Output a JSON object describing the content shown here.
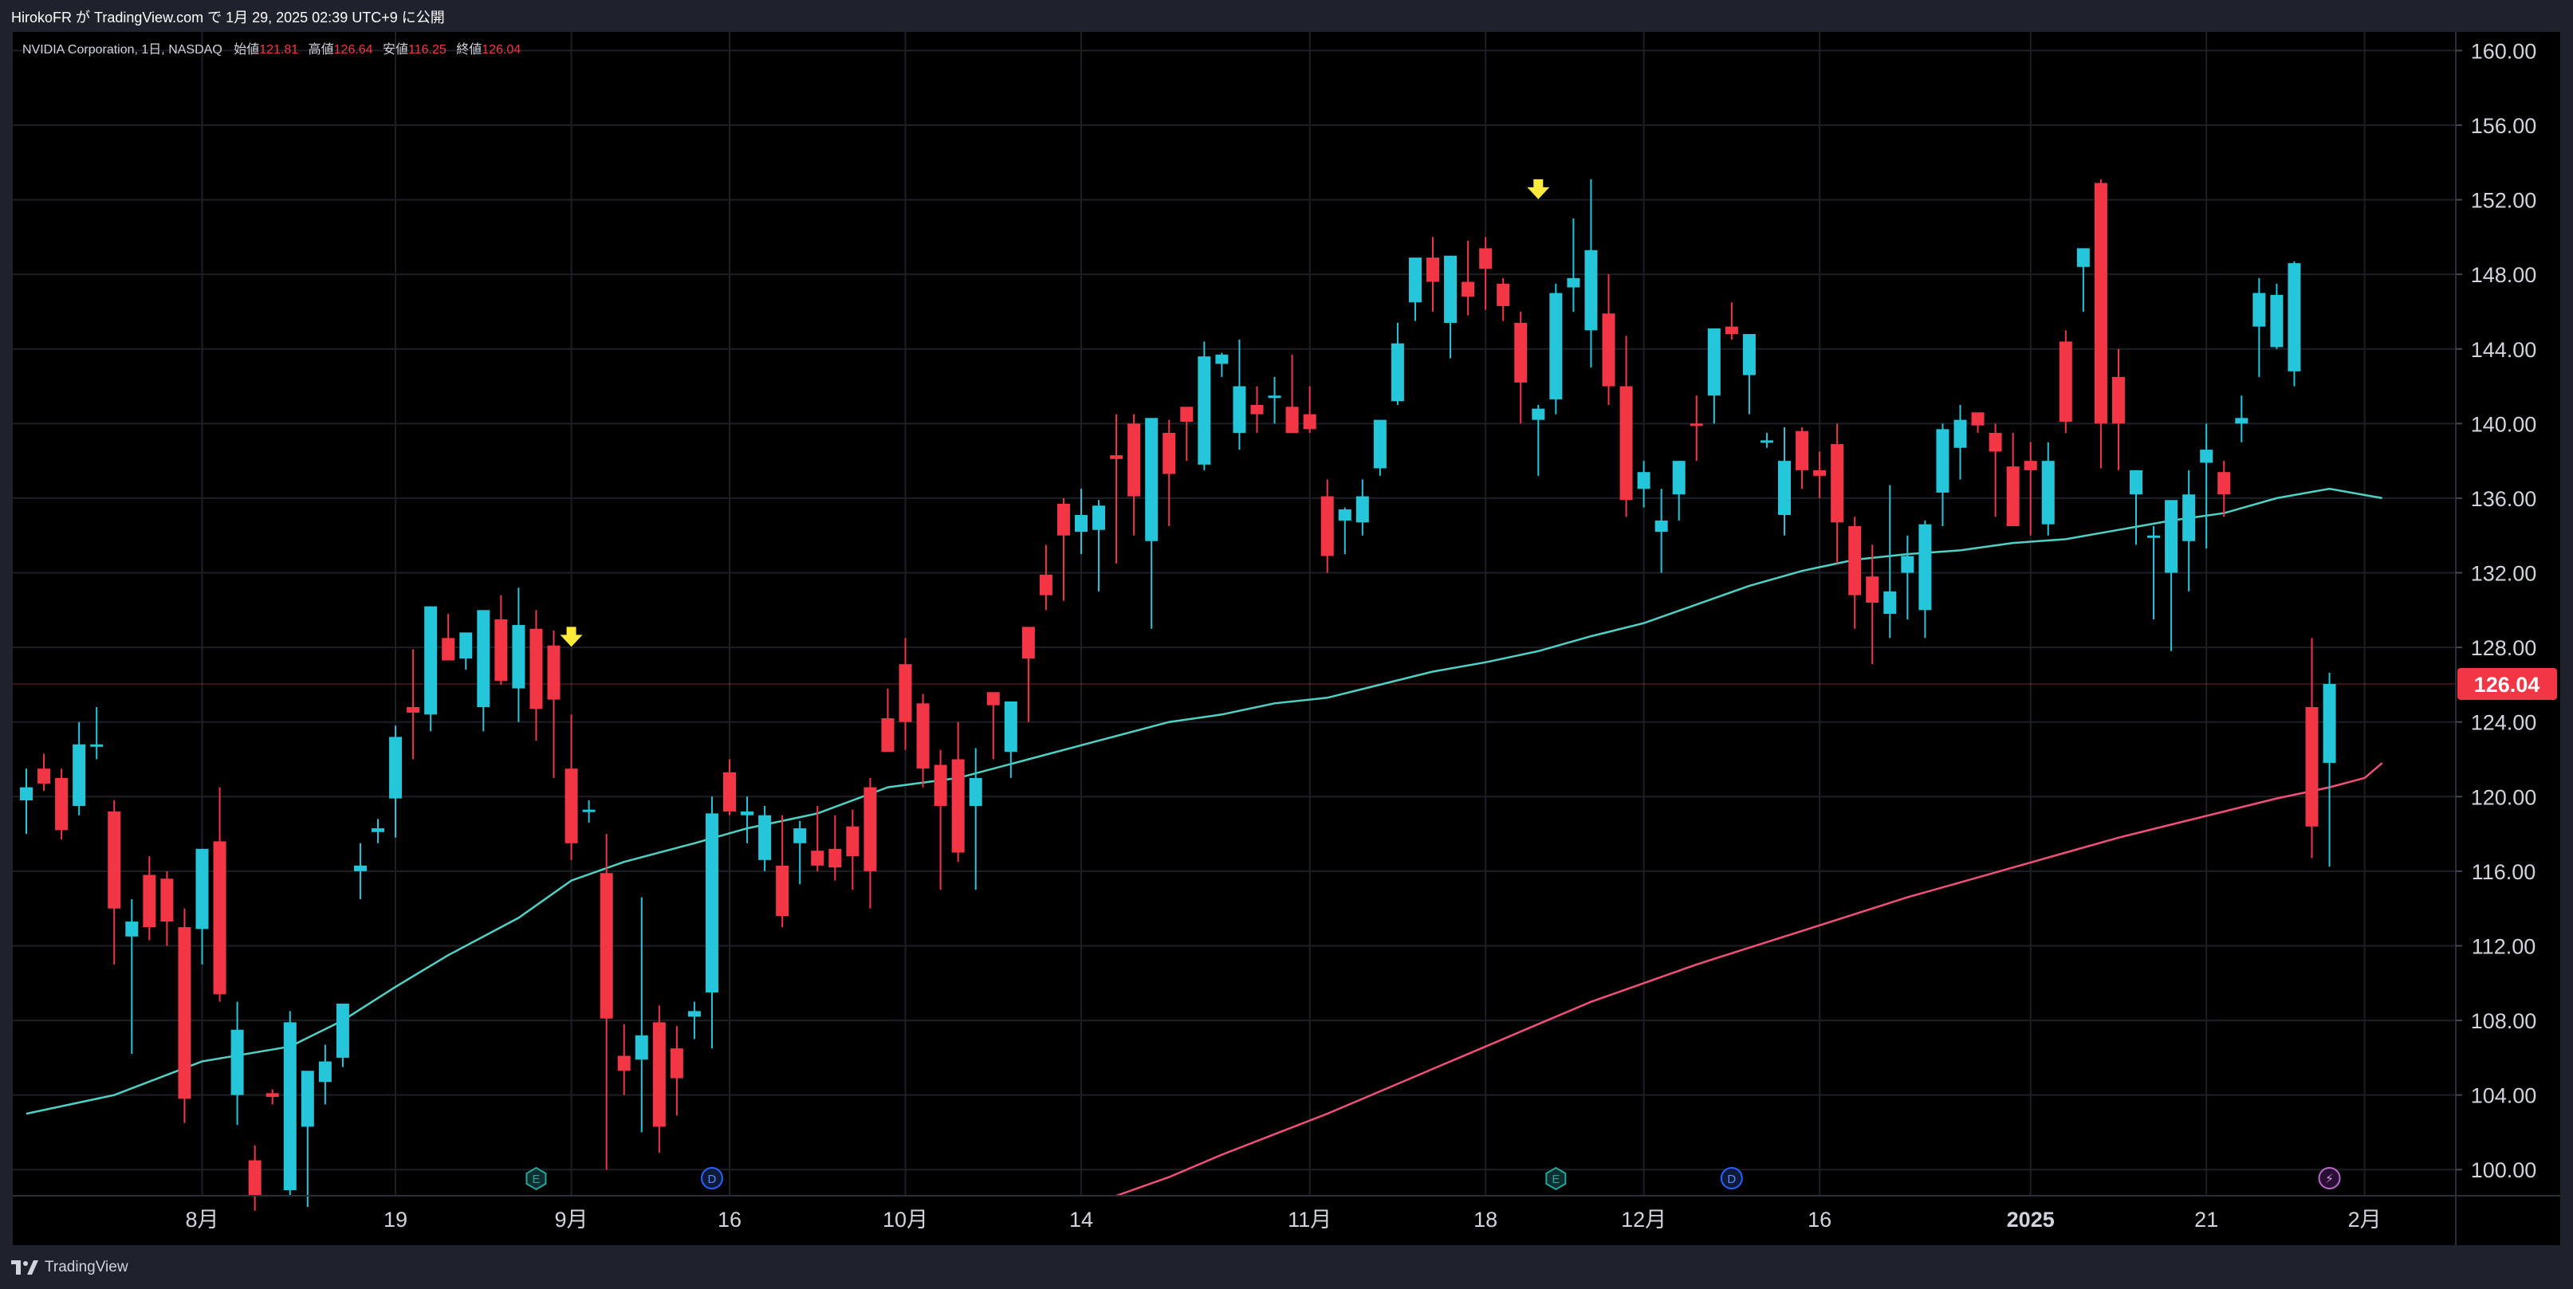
{
  "publish_line": "HirokoFR が TradingView.com で 1月 29, 2025 02:39 UTC+9 に公開",
  "brand": "TradingView",
  "colors": {
    "bull": "#26c6da",
    "bear": "#f23645",
    "ma_short": "#4fd1c5",
    "ma_long": "#f0507a",
    "marker": "#ffeb3b",
    "grid": "#1c1f26",
    "axis_text": "#d1d4dc",
    "last_price_line": "#f23645"
  },
  "legend": {
    "symbol": "NVIDIA Corporation, 1日, NASDAQ",
    "open_label": "始値",
    "open": "121.81",
    "high_label": "高値",
    "high": "126.64",
    "low_label": "安値",
    "low": "116.25",
    "close_label": "終値",
    "close": "126.04"
  },
  "chart_data": {
    "type": "candlestick",
    "symbol": "NVIDIA Corporation",
    "interval": "1日",
    "exchange": "NASDAQ",
    "y_ticks": [
      "160.00",
      "156.00",
      "152.00",
      "148.00",
      "144.00",
      "140.00",
      "136.00",
      "132.00",
      "128.00",
      "124.00",
      "120.00",
      "116.00",
      "112.00",
      "108.00",
      "104.00",
      "100.00"
    ],
    "ylim": [
      98.6,
      161.0
    ],
    "x_ticks": [
      {
        "label": "8月",
        "index": 10
      },
      {
        "label": "19",
        "index": 21
      },
      {
        "label": "9月",
        "index": 31
      },
      {
        "label": "16",
        "index": 40
      },
      {
        "label": "10月",
        "index": 50
      },
      {
        "label": "14",
        "index": 60
      },
      {
        "label": "11月",
        "index": 73
      },
      {
        "label": "18",
        "index": 83
      },
      {
        "label": "12月",
        "index": 92
      },
      {
        "label": "16",
        "index": 102
      },
      {
        "label": "2025",
        "index": 114,
        "bold": true
      },
      {
        "label": "21",
        "index": 124
      },
      {
        "label": "2月",
        "index": 133
      }
    ],
    "last_price": 126.04,
    "candles": [
      [
        119.8,
        121.5,
        118.0,
        120.5
      ],
      [
        121.5,
        122.3,
        120.3,
        120.7
      ],
      [
        121.0,
        121.5,
        117.7,
        118.2
      ],
      [
        119.5,
        124.0,
        119.0,
        122.8
      ],
      [
        122.7,
        124.8,
        122.0,
        122.8
      ],
      [
        119.2,
        119.8,
        111.0,
        114.0
      ],
      [
        112.5,
        114.5,
        106.2,
        113.3
      ],
      [
        115.8,
        116.8,
        112.3,
        113.0
      ],
      [
        115.6,
        116.0,
        112.0,
        113.3
      ],
      [
        113.0,
        114.0,
        102.5,
        103.8
      ],
      [
        112.9,
        116.8,
        111.0,
        117.2
      ],
      [
        117.6,
        120.5,
        109.0,
        109.4
      ],
      [
        104.0,
        109.0,
        102.4,
        107.5
      ],
      [
        100.5,
        101.3,
        97.8,
        98.6
      ],
      [
        104.1,
        104.3,
        103.5,
        103.9
      ],
      [
        98.9,
        108.5,
        98.6,
        107.9
      ],
      [
        102.3,
        105.1,
        98.0,
        105.3
      ],
      [
        104.7,
        106.7,
        103.5,
        105.8
      ],
      [
        106.0,
        108.0,
        105.5,
        108.9
      ],
      [
        116.0,
        117.5,
        114.5,
        116.3
      ],
      [
        118.1,
        118.8,
        117.5,
        118.3
      ],
      [
        119.9,
        123.8,
        117.8,
        123.2
      ],
      [
        124.8,
        127.9,
        122.0,
        124.5
      ],
      [
        124.4,
        130.2,
        123.5,
        130.2
      ],
      [
        128.5,
        129.8,
        127.8,
        127.3
      ],
      [
        127.4,
        128.8,
        126.8,
        128.8
      ],
      [
        124.8,
        130.0,
        123.5,
        130.0
      ],
      [
        129.5,
        130.8,
        126.0,
        126.2
      ],
      [
        125.8,
        131.2,
        124.0,
        129.2
      ],
      [
        129.0,
        130.0,
        123.0,
        124.7
      ],
      [
        128.1,
        128.9,
        121.0,
        125.2
      ],
      [
        121.5,
        124.4,
        116.6,
        117.5
      ],
      [
        119.3,
        119.8,
        118.6,
        119.3
      ],
      [
        115.9,
        118.0,
        100.0,
        108.1
      ],
      [
        106.1,
        107.8,
        104.0,
        105.3
      ],
      [
        105.9,
        114.6,
        102.0,
        107.2
      ],
      [
        107.9,
        108.8,
        100.9,
        102.3
      ],
      [
        106.5,
        107.7,
        102.9,
        104.9
      ],
      [
        108.2,
        109.0,
        107.0,
        108.5
      ],
      [
        109.5,
        120.0,
        106.5,
        119.1
      ],
      [
        121.3,
        122.0,
        119.0,
        119.2
      ],
      [
        119.0,
        120.0,
        117.5,
        119.2
      ],
      [
        116.6,
        119.5,
        116.0,
        119.0
      ],
      [
        116.3,
        119.0,
        113.0,
        113.6
      ],
      [
        117.5,
        118.7,
        115.3,
        118.3
      ],
      [
        117.1,
        119.5,
        116.0,
        116.3
      ],
      [
        117.2,
        119.0,
        115.5,
        116.2
      ],
      [
        118.4,
        119.3,
        115.0,
        116.8
      ],
      [
        120.5,
        121.0,
        114.0,
        116.0
      ],
      [
        124.2,
        125.8,
        123.5,
        122.4
      ],
      [
        127.1,
        128.5,
        122.5,
        124.0
      ],
      [
        125.0,
        125.5,
        120.5,
        121.5
      ],
      [
        121.7,
        122.5,
        115.0,
        119.5
      ],
      [
        122.0,
        124.0,
        116.5,
        117.0
      ],
      [
        119.5,
        122.6,
        115.0,
        121.0
      ],
      [
        125.6,
        125.5,
        122.0,
        124.9
      ],
      [
        122.4,
        124.9,
        121.0,
        125.1
      ],
      [
        129.1,
        129.0,
        124.0,
        127.4
      ],
      [
        131.9,
        133.5,
        130.0,
        130.8
      ],
      [
        135.7,
        136.0,
        130.5,
        134.0
      ],
      [
        134.2,
        136.5,
        133.0,
        135.1
      ],
      [
        134.3,
        135.9,
        131.0,
        135.6
      ],
      [
        138.3,
        140.5,
        132.5,
        138.1
      ],
      [
        140.0,
        140.5,
        134.0,
        136.1
      ],
      [
        133.7,
        139.5,
        129.0,
        140.3
      ],
      [
        139.5,
        140.2,
        134.5,
        137.3
      ],
      [
        140.9,
        140.5,
        138.0,
        140.1
      ],
      [
        137.8,
        144.4,
        137.5,
        143.6
      ],
      [
        143.2,
        143.8,
        142.5,
        143.7
      ],
      [
        139.5,
        144.5,
        138.6,
        142.0
      ],
      [
        141.0,
        142.0,
        139.5,
        140.5
      ],
      [
        141.4,
        142.5,
        140.0,
        141.5
      ],
      [
        140.9,
        143.7,
        139.5,
        139.5
      ],
      [
        140.5,
        142.0,
        139.5,
        139.7
      ],
      [
        136.1,
        137.0,
        132.0,
        132.9
      ],
      [
        134.8,
        135.5,
        133.0,
        135.4
      ],
      [
        134.7,
        137.0,
        134.0,
        136.1
      ],
      [
        137.6,
        139.7,
        137.2,
        140.2
      ],
      [
        141.2,
        145.4,
        141.0,
        144.3
      ],
      [
        146.5,
        147.5,
        145.5,
        148.9
      ],
      [
        148.9,
        150.0,
        146.0,
        147.6
      ],
      [
        145.4,
        149.0,
        143.5,
        149.0
      ],
      [
        147.6,
        149.8,
        145.8,
        146.8
      ],
      [
        149.4,
        150.0,
        146.1,
        148.3
      ],
      [
        147.5,
        147.8,
        145.5,
        146.3
      ],
      [
        145.4,
        146.0,
        140.0,
        142.2
      ],
      [
        140.2,
        141.0,
        137.2,
        140.8
      ],
      [
        141.3,
        147.5,
        140.5,
        147.0
      ],
      [
        147.3,
        151.0,
        146.0,
        147.8
      ],
      [
        145.0,
        153.1,
        143.0,
        149.3
      ],
      [
        145.9,
        148.0,
        141.0,
        142.0
      ],
      [
        142.0,
        144.7,
        135.0,
        135.9
      ],
      [
        136.5,
        138.0,
        135.5,
        137.4
      ],
      [
        134.2,
        136.5,
        132.0,
        134.8
      ],
      [
        136.2,
        138.0,
        134.8,
        138.0
      ],
      [
        140.0,
        141.5,
        138.0,
        139.9
      ],
      [
        141.5,
        145.0,
        140.0,
        145.1
      ],
      [
        145.2,
        146.5,
        144.5,
        144.8
      ],
      [
        142.6,
        144.5,
        140.5,
        144.8
      ],
      [
        139.0,
        139.5,
        138.7,
        139.1
      ],
      [
        135.1,
        139.8,
        134.0,
        138.0
      ],
      [
        139.6,
        139.8,
        136.5,
        137.5
      ],
      [
        137.5,
        138.5,
        136.0,
        137.2
      ],
      [
        138.9,
        140.0,
        132.5,
        134.7
      ],
      [
        134.5,
        135.0,
        129.0,
        130.8
      ],
      [
        131.8,
        133.5,
        127.1,
        130.4
      ],
      [
        129.8,
        136.7,
        128.5,
        131.0
      ],
      [
        132.0,
        134.0,
        129.5,
        132.9
      ],
      [
        130.0,
        134.8,
        128.5,
        134.6
      ],
      [
        136.3,
        140.0,
        134.5,
        139.7
      ],
      [
        138.7,
        141.0,
        137.0,
        140.2
      ],
      [
        140.6,
        140.5,
        139.5,
        139.9
      ],
      [
        139.5,
        140.0,
        135.0,
        138.5
      ],
      [
        137.7,
        139.5,
        134.5,
        134.5
      ],
      [
        138.0,
        139.0,
        134.0,
        137.5
      ],
      [
        134.6,
        139.0,
        134.0,
        138.0
      ],
      [
        144.4,
        145.0,
        139.5,
        140.1
      ],
      [
        148.4,
        149.4,
        146.0,
        149.4
      ],
      [
        152.9,
        153.1,
        137.6,
        140.0
      ],
      [
        142.5,
        144.0,
        137.5,
        140.0
      ],
      [
        136.2,
        137.5,
        133.5,
        137.5
      ],
      [
        133.9,
        134.5,
        129.5,
        134.0
      ],
      [
        132.0,
        133.5,
        127.8,
        135.9
      ],
      [
        133.7,
        137.5,
        131.0,
        136.2
      ],
      [
        137.9,
        140.0,
        133.3,
        138.6
      ],
      [
        137.4,
        138.0,
        135.0,
        136.2
      ],
      [
        140.0,
        141.5,
        139.0,
        140.3
      ],
      [
        145.2,
        147.8,
        142.5,
        147.0
      ],
      [
        144.1,
        147.5,
        144.0,
        146.9
      ],
      [
        142.8,
        148.7,
        142.0,
        148.6
      ],
      [
        124.8,
        128.5,
        116.7,
        118.4
      ],
      [
        121.81,
        126.64,
        116.25,
        126.04
      ]
    ],
    "ma_short": [
      [
        0,
        103.0
      ],
      [
        5,
        104.0
      ],
      [
        10,
        105.8
      ],
      [
        15,
        106.6
      ],
      [
        18,
        108.0
      ],
      [
        21,
        109.8
      ],
      [
        24,
        111.5
      ],
      [
        28,
        113.5
      ],
      [
        31,
        115.5
      ],
      [
        34,
        116.5
      ],
      [
        38,
        117.5
      ],
      [
        41,
        118.3
      ],
      [
        45,
        119.1
      ],
      [
        49,
        120.5
      ],
      [
        53,
        121.0
      ],
      [
        57,
        122.0
      ],
      [
        61,
        123.0
      ],
      [
        65,
        124.0
      ],
      [
        68,
        124.4
      ],
      [
        71,
        125.0
      ],
      [
        74,
        125.3
      ],
      [
        77,
        126.0
      ],
      [
        80,
        126.7
      ],
      [
        83,
        127.2
      ],
      [
        86,
        127.8
      ],
      [
        89,
        128.6
      ],
      [
        92,
        129.3
      ],
      [
        95,
        130.3
      ],
      [
        98,
        131.3
      ],
      [
        101,
        132.1
      ],
      [
        104,
        132.7
      ],
      [
        107,
        133.0
      ],
      [
        110,
        133.2
      ],
      [
        113,
        133.6
      ],
      [
        116,
        133.8
      ],
      [
        119,
        134.3
      ],
      [
        122,
        134.8
      ],
      [
        125,
        135.2
      ],
      [
        128,
        136.0
      ],
      [
        131,
        136.5
      ],
      [
        134,
        136.0
      ]
    ],
    "ma_long": [
      [
        62,
        98.6
      ],
      [
        65,
        99.6
      ],
      [
        68,
        100.8
      ],
      [
        71,
        101.9
      ],
      [
        74,
        103.0
      ],
      [
        77,
        104.2
      ],
      [
        80,
        105.4
      ],
      [
        83,
        106.6
      ],
      [
        86,
        107.8
      ],
      [
        89,
        109.0
      ],
      [
        92,
        110.0
      ],
      [
        95,
        111.0
      ],
      [
        98,
        111.9
      ],
      [
        101,
        112.8
      ],
      [
        104,
        113.7
      ],
      [
        107,
        114.6
      ],
      [
        110,
        115.4
      ],
      [
        113,
        116.2
      ],
      [
        116,
        117.0
      ],
      [
        119,
        117.8
      ],
      [
        122,
        118.5
      ],
      [
        125,
        119.2
      ],
      [
        128,
        119.9
      ],
      [
        131,
        120.5
      ],
      [
        133,
        121.0
      ],
      [
        134,
        121.8
      ]
    ],
    "markers": [
      {
        "type": "arrow-down",
        "index": 31,
        "price": 128.5
      },
      {
        "type": "arrow-down",
        "index": 86,
        "price": 152.5
      }
    ],
    "events": [
      {
        "label": "E",
        "index": 29
      },
      {
        "label": "D",
        "index": 39
      },
      {
        "label": "E",
        "index": 87
      },
      {
        "label": "D",
        "index": 97
      },
      {
        "label": "⚡",
        "index": 131
      }
    ]
  }
}
